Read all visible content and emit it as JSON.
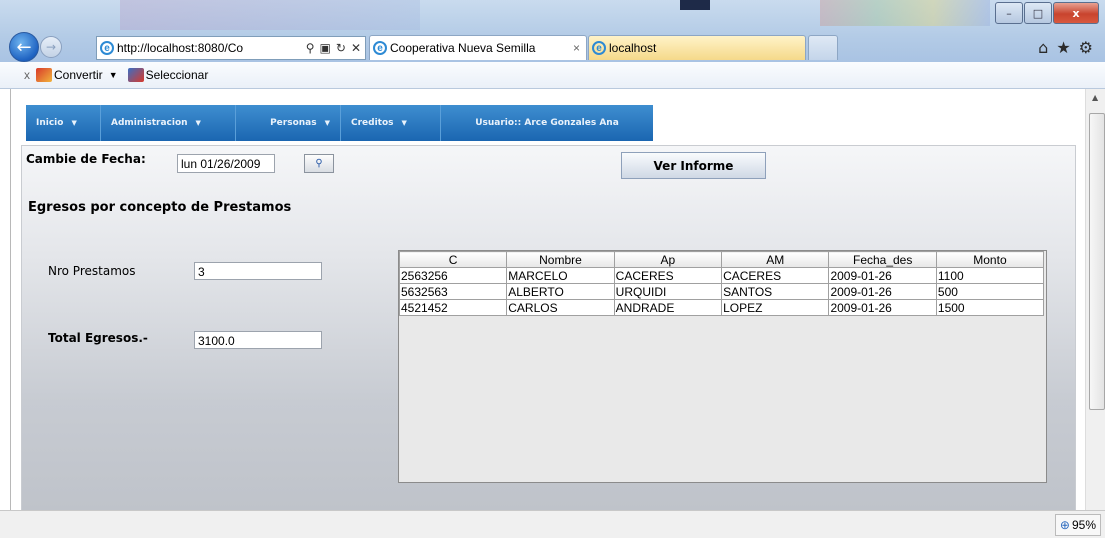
{
  "browser": {
    "url": "http://localhost:8080/Co",
    "tabs": [
      {
        "label": "Cooperativa Nueva Semilla",
        "close": "×"
      },
      {
        "label": "localhost"
      }
    ],
    "window_controls": {
      "min": "–",
      "max": "□",
      "close": "x"
    },
    "command_bar": {
      "convert_label": "Convertir",
      "select_label": "Seleccionar",
      "close_glyph": "x"
    },
    "zoom_level": "95%"
  },
  "menu": {
    "items": [
      {
        "label": "Inicio"
      },
      {
        "label": "Administracion"
      },
      {
        "label": "Personas"
      },
      {
        "label": "Creditos"
      },
      {
        "label": "Usuario:: Arce Gonzales Ana"
      }
    ]
  },
  "form": {
    "date_label": "Cambie de Fecha:",
    "date_value": "lun 01/26/2009",
    "report_button": "Ver Informe",
    "section_title": "Egresos por concepto de Prestamos",
    "loans_label": "Nro Prestamos",
    "loans_value": "3",
    "total_label": "Total Egresos.-",
    "total_value": "3100.0"
  },
  "table": {
    "columns": [
      "C",
      "Nombre",
      "Ap",
      "AM",
      "Fecha_des",
      "Monto"
    ],
    "rows": [
      [
        "2563256",
        "MARCELO",
        "CACERES",
        "CACERES",
        "2009-01-26",
        "1100"
      ],
      [
        "5632563",
        "ALBERTO",
        "URQUIDI",
        "SANTOS",
        "2009-01-26",
        "500"
      ],
      [
        "4521452",
        "CARLOS",
        "ANDRADE",
        "LOPEZ",
        "2009-01-26",
        "1500"
      ]
    ]
  },
  "colors": {
    "menu_blue": "#2a78c3",
    "panel_gray": "#c7cbd2"
  }
}
